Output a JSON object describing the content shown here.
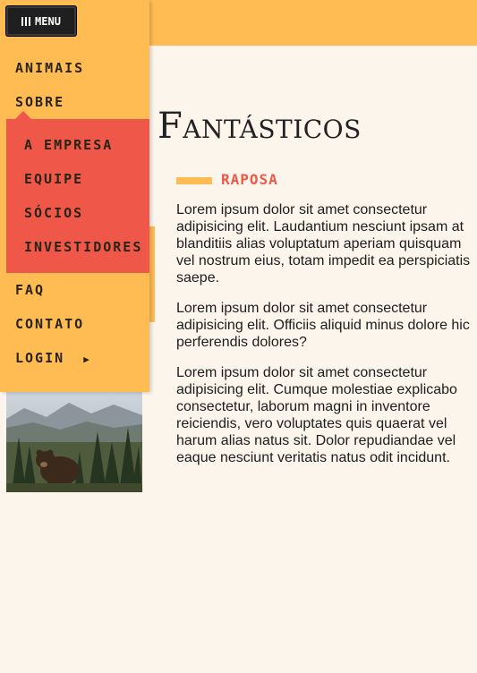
{
  "menu_button": {
    "label": "MENU"
  },
  "sidebar": {
    "items": [
      {
        "label": "ANIMAIS"
      },
      {
        "label": "SOBRE"
      },
      {
        "label": "FAQ"
      },
      {
        "label": "CONTATO"
      },
      {
        "label": "LOGIN"
      }
    ],
    "submenu": [
      {
        "label": "A EMPRESA"
      },
      {
        "label": "EQUIPE"
      },
      {
        "label": "SÓCIOS"
      },
      {
        "label": "INVESTIDORES"
      }
    ]
  },
  "main": {
    "title": "Fantásticos",
    "subtitle": "RAPOSA",
    "paragraphs": [
      "Lorem ipsum dolor sit amet consectetur adipisicing elit. Laudantium nesciunt ipsam at blanditiis alias voluptatum aperiam quisquam vel nostrum eius, totam impedit ea perspiciatis saepe.",
      "Lorem ipsum dolor sit amet consectetur adipisicing elit. Officiis aliquid minus dolore hic perferendis dolores?",
      "Lorem ipsum dolor sit amet consectetur adipisicing elit. Cumque molestiae explicabo consectetur, laborum magni in inventore reiciendis, vero voluptates quis quaerat vel harum alias natus sit. Dolor repudiandae vel eaque nesciunt veritatis natus odit incidunt."
    ]
  },
  "colors": {
    "accent_yellow": "#ffbc53",
    "accent_red": "#ef5848",
    "background": "#fbf5ec",
    "button_dark": "#1f1f1f"
  },
  "icons": {
    "menu": "menu-bars-icon",
    "login_caret": "caret-right-icon"
  }
}
